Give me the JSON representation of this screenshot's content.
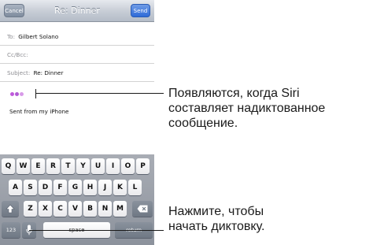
{
  "navbar": {
    "cancel_label": "Cancel",
    "title": "Re: Dinner",
    "send_label": "Send"
  },
  "fields": {
    "to_label": "To:",
    "to_value": "Gilbert Solano",
    "cc_label": "Cc/Bcc:",
    "subject_label": "Subject:",
    "subject_value": "Re: Dinner"
  },
  "body": {
    "signature": "Sent from my iPhone"
  },
  "keyboard": {
    "row1": [
      "Q",
      "W",
      "E",
      "R",
      "T",
      "Y",
      "U",
      "I",
      "O",
      "P"
    ],
    "row2": [
      "A",
      "S",
      "D",
      "F",
      "G",
      "H",
      "J",
      "K",
      "L"
    ],
    "row3": [
      "Z",
      "X",
      "C",
      "V",
      "B",
      "N",
      "M"
    ],
    "numbers_label": "123",
    "space_label": "space",
    "return_label": "return",
    "shift_icon": "shift-arrow-icon",
    "delete_icon": "delete-backspace-icon",
    "mic_icon": "microphone-icon"
  },
  "callouts": {
    "dictation_note_line1": "Появляются, когда Siri",
    "dictation_note_line2": "составляет надиктованное",
    "dictation_note_line3": "сообщение.",
    "mic_note_line1": "Нажмите, чтобы",
    "mic_note_line2": "начать диктовку."
  },
  "colors": {
    "send_button": "#2f6bd8",
    "dictation_dots": "#c05bdc",
    "keyboard_bg": "#8c929c"
  }
}
